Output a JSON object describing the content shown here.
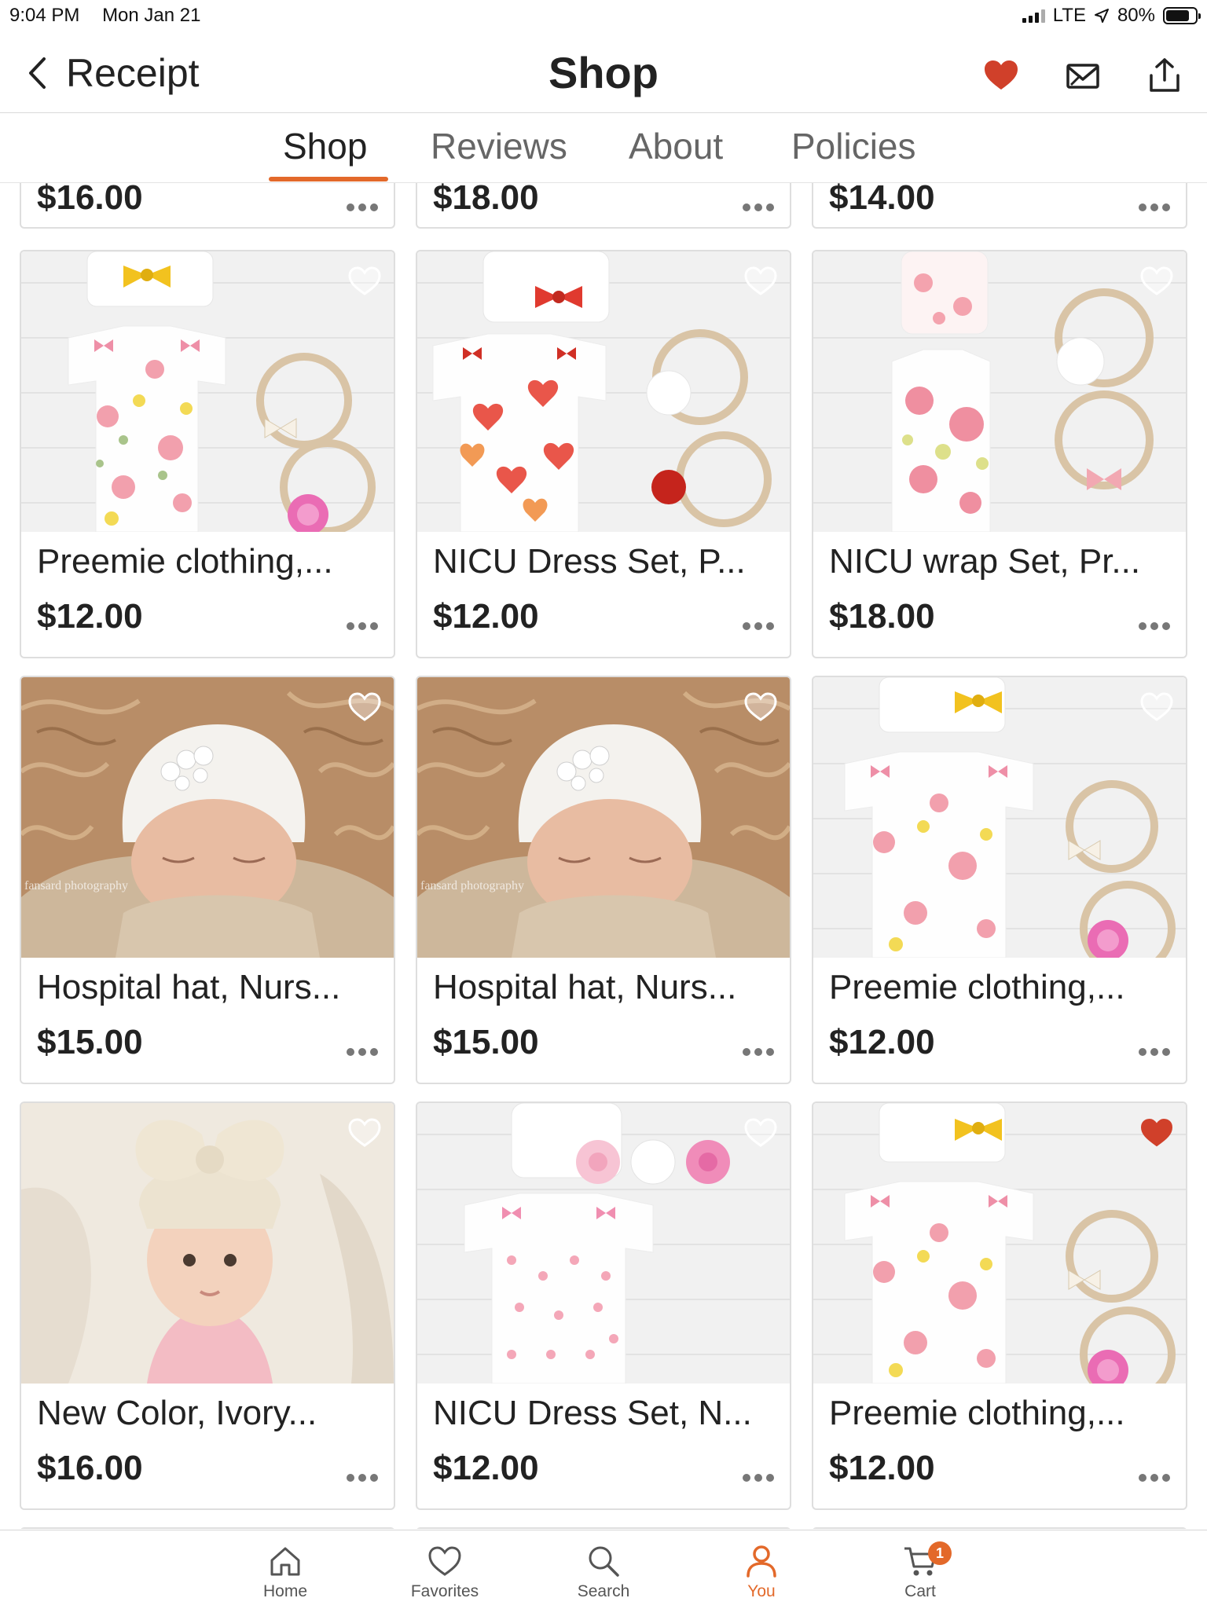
{
  "status_bar": {
    "time": "9:04 PM",
    "date": "Mon Jan 21",
    "network": "LTE",
    "battery": "80%",
    "battery_level": 0.8,
    "icons": [
      "signal-icon",
      "location-arrow-icon",
      "battery-icon"
    ]
  },
  "nav": {
    "back_label": "Receipt",
    "title": "Shop",
    "icons": [
      "favorite-heart-icon",
      "message-icon",
      "share-icon"
    ]
  },
  "tabs": [
    {
      "label": "Shop",
      "active": true
    },
    {
      "label": "Reviews",
      "active": false
    },
    {
      "label": "About",
      "active": false
    },
    {
      "label": "Policies",
      "active": false
    }
  ],
  "top_partial_row": [
    {
      "price": "$16.00"
    },
    {
      "price": "$18.00"
    },
    {
      "price": "$14.00"
    }
  ],
  "listings": [
    {
      "title": "Preemie clothing,...",
      "price": "$12.00",
      "favorited": false,
      "image": "floral-preemie-gown-set"
    },
    {
      "title": "NICU Dress Set, P...",
      "price": "$12.00",
      "favorited": false,
      "image": "heart-print-nicu-dress-set"
    },
    {
      "title": "NICU wrap Set, Pr...",
      "price": "$18.00",
      "favorited": false,
      "image": "floral-nicu-wrap-set"
    },
    {
      "title": "Hospital hat, Nurs...",
      "price": "$15.00",
      "favorited": false,
      "image": "newborn-crown-hat-photo"
    },
    {
      "title": "Hospital hat, Nurs...",
      "price": "$15.00",
      "favorited": false,
      "image": "newborn-crown-hat-photo"
    },
    {
      "title": "Preemie clothing,...",
      "price": "$12.00",
      "favorited": false,
      "image": "floral-preemie-gown-set"
    },
    {
      "title": "New Color, Ivory...",
      "price": "$16.00",
      "favorited": false,
      "image": "baby-ivory-headband-photo"
    },
    {
      "title": "NICU Dress Set, N...",
      "price": "$12.00",
      "favorited": false,
      "image": "pink-flower-nicu-dress-set"
    },
    {
      "title": "Preemie clothing,...",
      "price": "$12.00",
      "favorited": true,
      "image": "floral-preemie-gown-set"
    }
  ],
  "photo_watermark": "fansard photography",
  "bottom_nav": [
    {
      "label": "Home",
      "icon": "home-icon",
      "active": false
    },
    {
      "label": "Favorites",
      "icon": "heart-outline-icon",
      "active": false
    },
    {
      "label": "Search",
      "icon": "search-icon",
      "active": false
    },
    {
      "label": "You",
      "icon": "person-icon",
      "active": true
    },
    {
      "label": "Cart",
      "icon": "cart-icon",
      "active": false,
      "badge": "1"
    }
  ],
  "colors": {
    "accent": "#e3692a",
    "favorite_red": "#d0402a",
    "text": "#222222",
    "muted": "#666666"
  }
}
